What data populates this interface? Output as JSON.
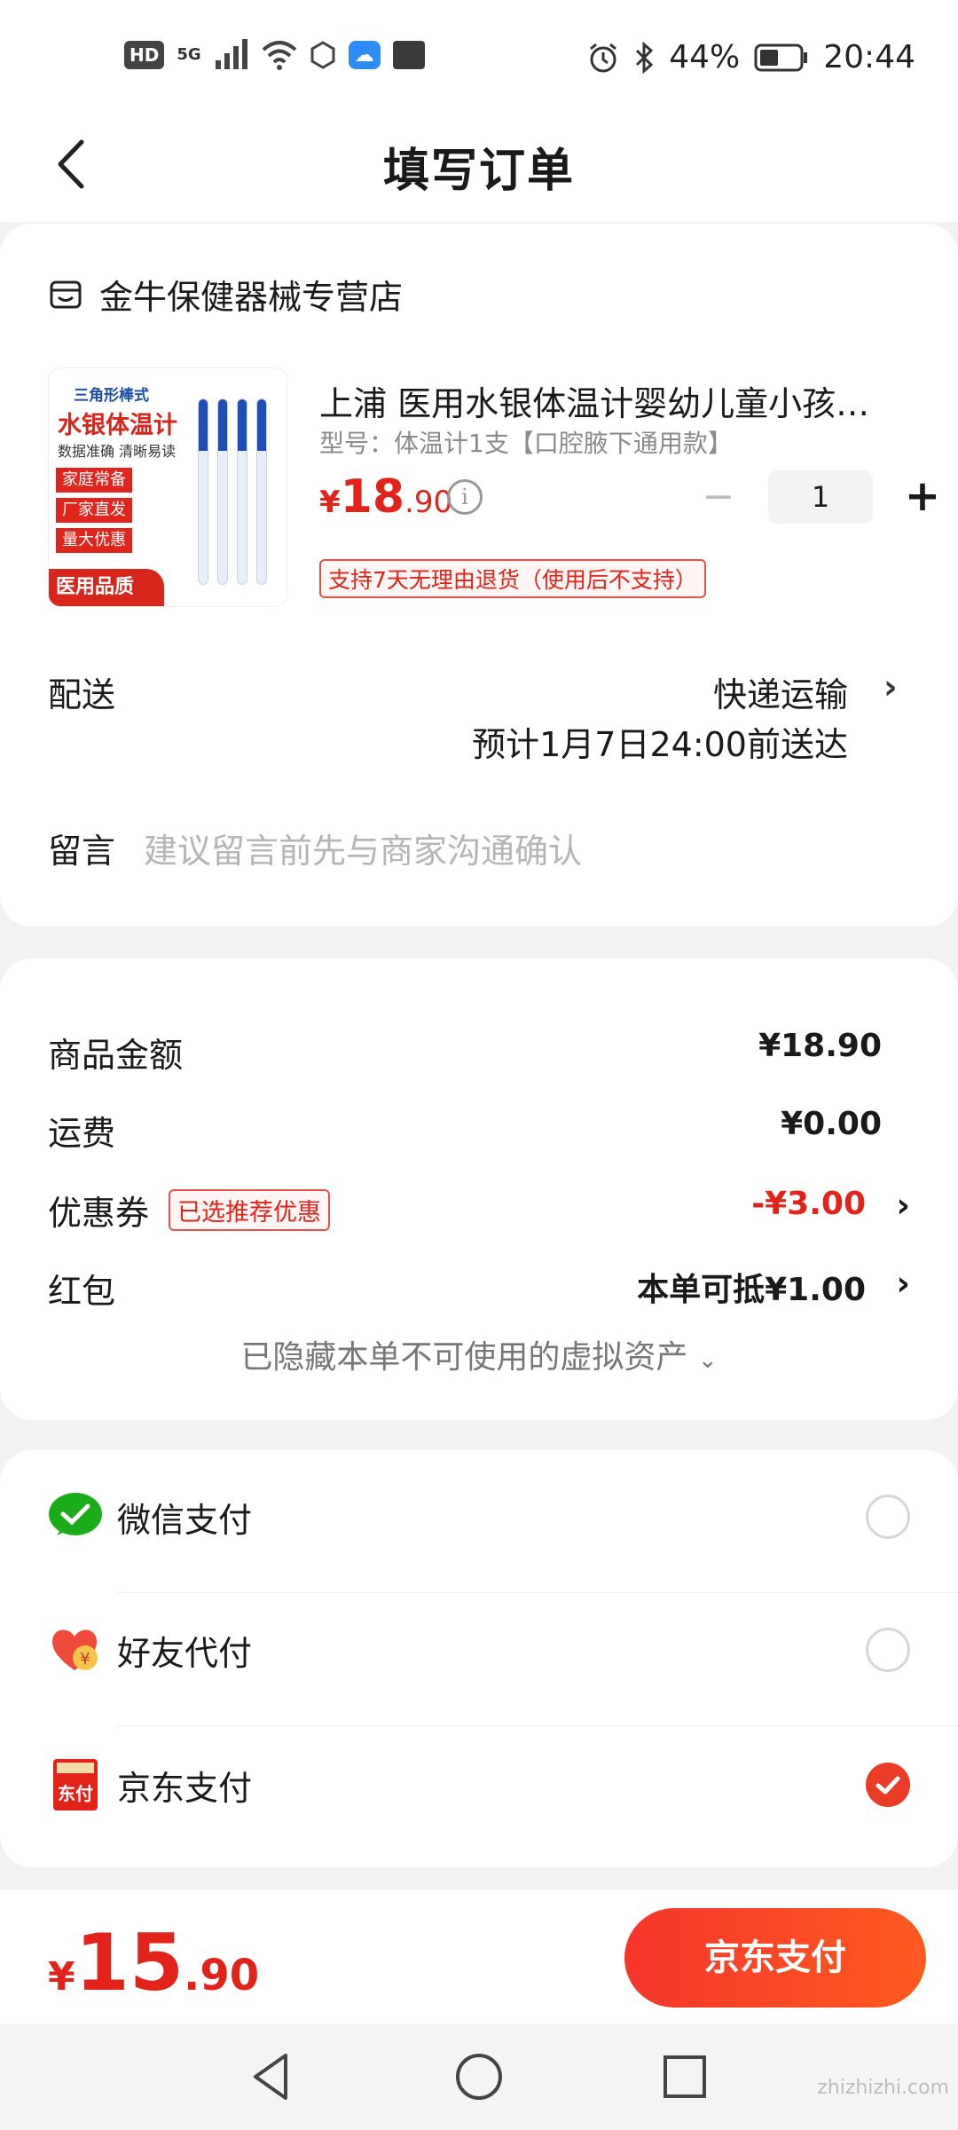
{
  "status_bar": {
    "hd": "HD",
    "network": "5G",
    "battery": "44%",
    "time": "20:44"
  },
  "header": {
    "title": "填写订单"
  },
  "shop": {
    "name": "金牛保健器械专营店"
  },
  "product": {
    "image_text": {
      "line1": "三角形棒式",
      "line2": "水银体温计",
      "line3": "数据准确 清晰易读",
      "tags": [
        "家庭常备",
        "厂家直发",
        "量大优惠"
      ],
      "bottom": "医用品质"
    },
    "title": "上浦 医用水银体温计婴幼儿童小孩…",
    "spec": "型号：体温计1支【口腔腋下通用款】",
    "price_symbol": "¥",
    "price_int": "18",
    "price_dec": ".90",
    "quantity": "1",
    "return_policy": "支持7天无理由退货（使用后不支持）"
  },
  "delivery": {
    "label": "配送",
    "method": "快递运输",
    "eta": "预计1月7日24:00前送达"
  },
  "note": {
    "label": "留言",
    "placeholder": "建议留言前先与商家沟通确认"
  },
  "amounts": {
    "goods_label": "商品金额",
    "goods_value": "¥18.90",
    "shipping_label": "运费",
    "shipping_value": "¥0.00",
    "coupon_label": "优惠券",
    "coupon_tag": "已选推荐优惠",
    "coupon_value": "-¥3.00",
    "redpacket_label": "红包",
    "redpacket_value": "本单可抵¥1.00",
    "hidden_assets": "已隐藏本单不可使用的虚拟资产"
  },
  "payment": {
    "options": [
      {
        "label": "微信支付",
        "selected": false
      },
      {
        "label": "好友代付",
        "selected": false
      },
      {
        "label": "京东支付",
        "selected": true
      }
    ],
    "jd_icon_text": "东付",
    "friend_icon_text": "¥"
  },
  "footer": {
    "total_symbol": "¥",
    "total_int": "15",
    "total_dec": ".90",
    "pay_button": "京东支付"
  },
  "watermark": "zhizhizhi.com",
  "colors": {
    "accent": "#e2231a",
    "wechat": "#1aad19",
    "background": "#f2f2f2"
  }
}
